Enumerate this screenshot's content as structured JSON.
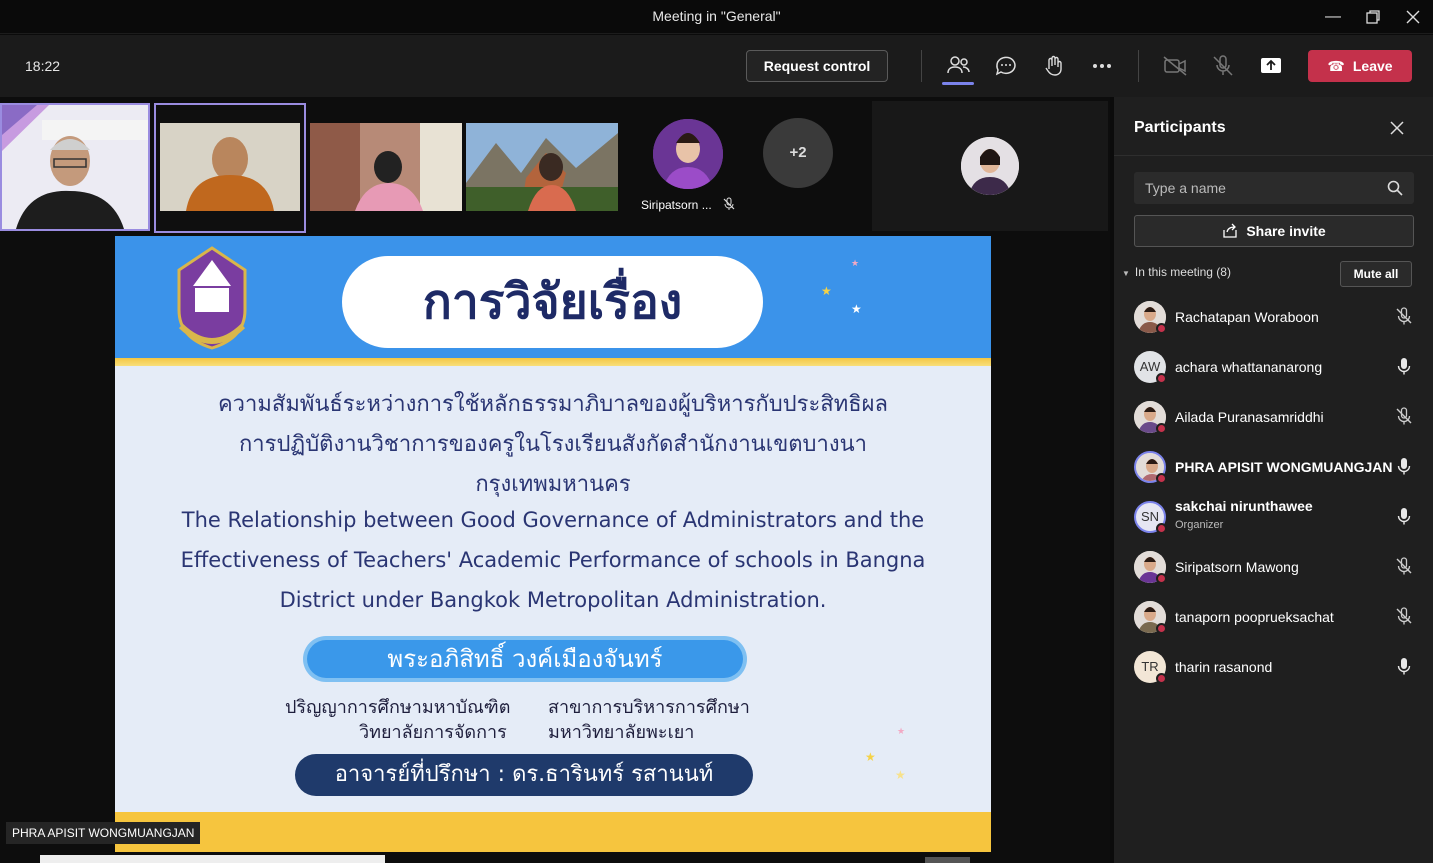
{
  "window": {
    "title": "Meeting in \"General\""
  },
  "toolbar": {
    "clock": "18:22",
    "request_control": "Request control",
    "leave": "Leave"
  },
  "gallery": {
    "more_count": "+2",
    "named_tile": "Siripatsorn ..."
  },
  "slide": {
    "title": "การวิจัยเรื่อง",
    "thai_lines": [
      "ความสัมพันธ์ระหว่างการใช้หลักธรรมาภิบาลของผู้บริหารกับประสิทธิผล",
      "การปฏิบัติงานวิชาการของครูในโรงเรียนสังกัดสำนักงานเขตบางนา",
      "กรุงเทพมหานคร"
    ],
    "english_lines": [
      "The Relationship between Good Governance of Administrators and the",
      "Effectiveness of Teachers' Academic Performance of schools in Bangna",
      "District under Bangkok Metropolitan Administration."
    ],
    "author": "พระอภิสิทธิ์ วงค์เมืองจันทร์",
    "degree_left_1": "ปริญญาการศึกษามหาบัณฑิต",
    "degree_left_2": "วิทยาลัยการจัดการ",
    "degree_right_1": "สาขาการบริหารการศึกษา",
    "degree_right_2": "มหาวิทยาลัยพะเยา",
    "advisor": "อาจารย์ที่ปรึกษา :   ดร.ธารินทร์ รสานนท์"
  },
  "presenter_tag": "PHRA APISIT WONGMUANGJAN",
  "participants_panel": {
    "title": "Participants",
    "search_placeholder": "Type a name",
    "share_invite": "Share invite",
    "in_meeting": "In this meeting (8)",
    "mute_all": "Mute all",
    "people": [
      {
        "name": "Rachatapan Woraboon",
        "initials": "",
        "role": "",
        "mic": "muted",
        "bold": false
      },
      {
        "name": "achara whattananarong",
        "initials": "AW",
        "role": "",
        "mic": "on",
        "bold": false
      },
      {
        "name": "Ailada Puranasamriddhi",
        "initials": "",
        "role": "",
        "mic": "muted",
        "bold": false
      },
      {
        "name": "PHRA APISIT WONGMUANGJAN",
        "initials": "",
        "role": "",
        "mic": "on",
        "bold": true
      },
      {
        "name": "sakchai nirunthawee",
        "initials": "SN",
        "role": "Organizer",
        "mic": "on",
        "bold": true
      },
      {
        "name": "Siripatsorn Mawong",
        "initials": "",
        "role": "",
        "mic": "muted",
        "bold": false
      },
      {
        "name": "tanaporn pooprueksachat",
        "initials": "",
        "role": "",
        "mic": "muted",
        "bold": false
      },
      {
        "name": "tharin rasanond",
        "initials": "TR",
        "role": "",
        "mic": "on",
        "bold": false
      }
    ]
  },
  "colors": {
    "accent": "#7b83eb",
    "leave": "#c4314b",
    "slide_blue": "#3b93ea",
    "slide_navy": "#1e2a66"
  }
}
